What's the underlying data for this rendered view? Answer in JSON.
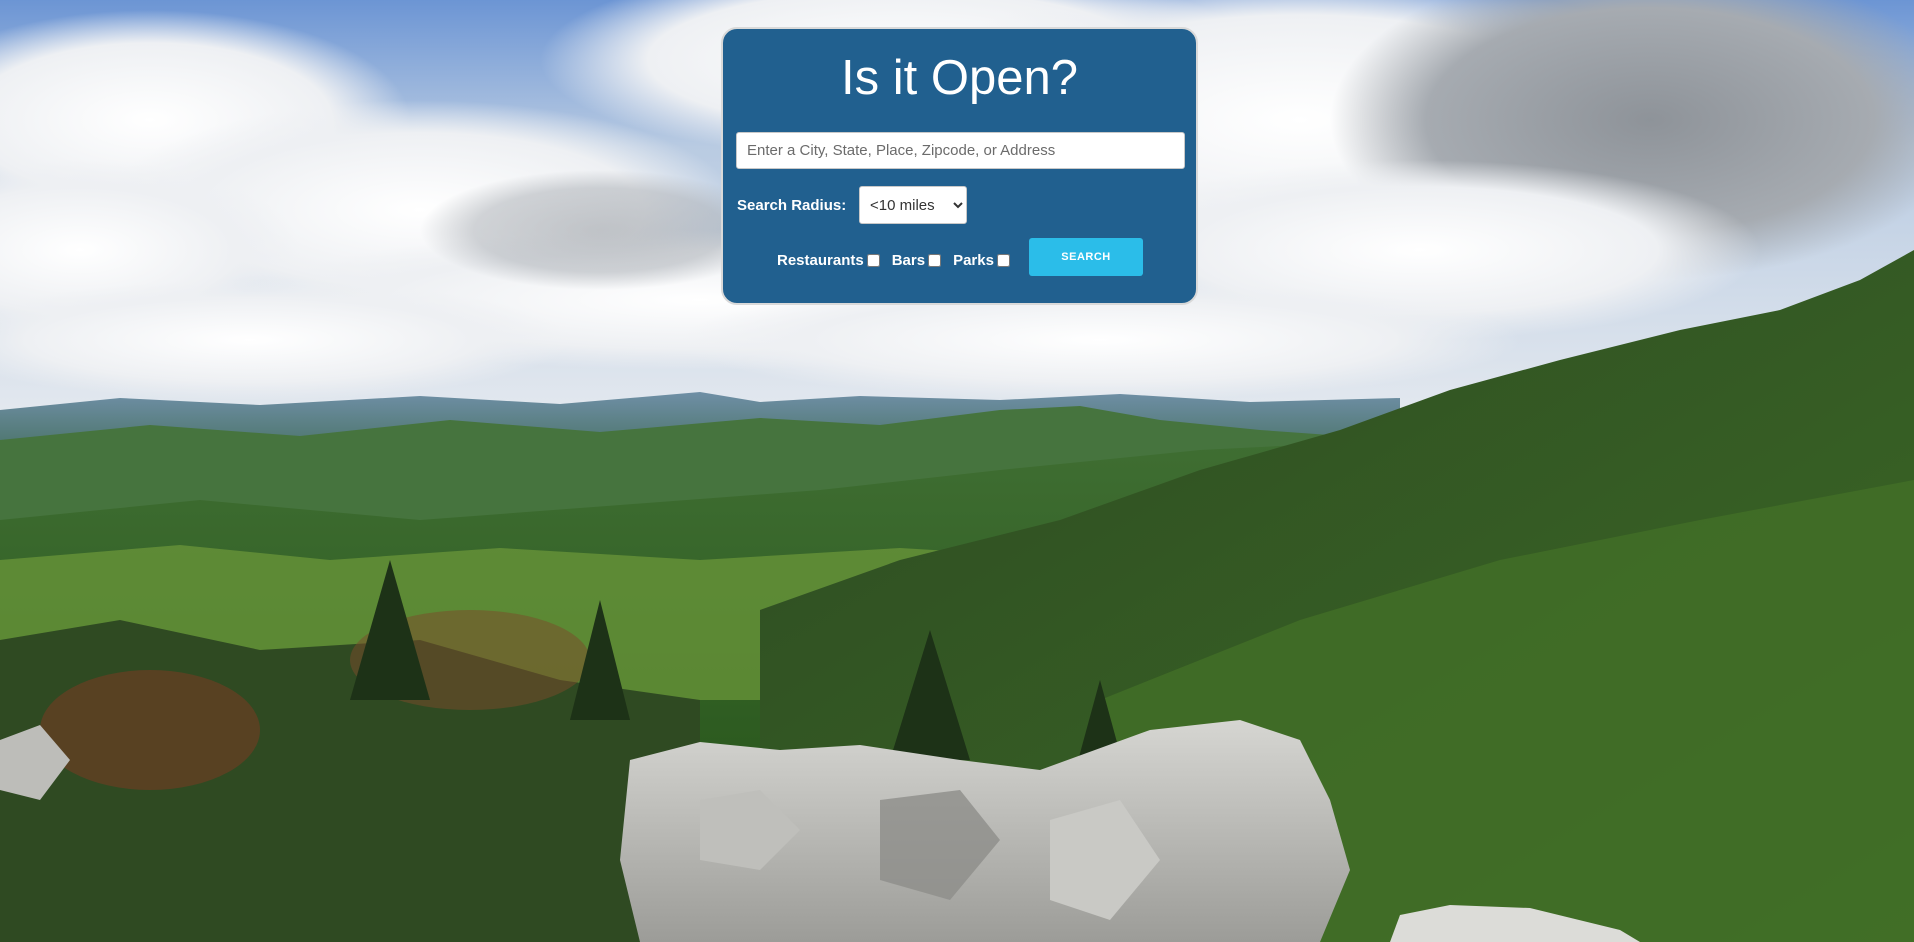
{
  "header": {
    "title": "Is it Open?"
  },
  "search": {
    "placeholder": "Enter a City, State, Place, Zipcode, or Address",
    "value": ""
  },
  "radius": {
    "label": "Search Radius:",
    "selected": "<10 miles"
  },
  "filters": [
    {
      "label": "Restaurants",
      "checked": false
    },
    {
      "label": "Bars",
      "checked": false
    },
    {
      "label": "Parks",
      "checked": false
    }
  ],
  "actions": {
    "search_label": "SEARCH"
  },
  "colors": {
    "card_background": "#21608f",
    "button_background": "#2bbde9",
    "text": "#ffffff"
  },
  "background": {
    "icon": "mountain-landscape-photo"
  }
}
